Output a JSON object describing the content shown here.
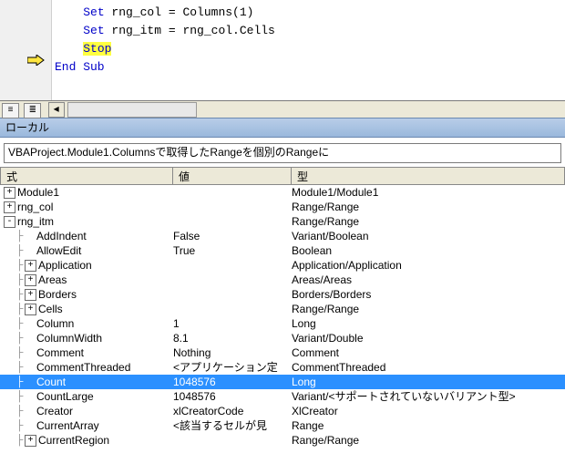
{
  "code": {
    "lines": [
      {
        "prefix": "Set",
        "rest": " rng_col = Columns(1)",
        "indent": 1
      },
      {
        "prefix": "Set",
        "rest": " rng_itm = rng_col.Cells",
        "indent": 1
      },
      {
        "prefix": "Stop",
        "rest": "",
        "indent": 1,
        "highlight": true,
        "marker": true
      },
      {
        "prefix": "End Sub",
        "rest": "",
        "indent": 0
      }
    ]
  },
  "locals_title": "ローカル",
  "context": "VBAProject.Module1.Columnsで取得したRangeを個別のRangeに",
  "headers": {
    "expr": "式",
    "val": "値",
    "type": "型"
  },
  "rows": [
    {
      "d": 0,
      "t": "+",
      "n": "Module1",
      "v": "",
      "ty": "Module1/Module1"
    },
    {
      "d": 0,
      "t": "+",
      "n": "rng_col",
      "v": "",
      "ty": "Range/Range"
    },
    {
      "d": 0,
      "t": "-",
      "n": "rng_itm",
      "v": "",
      "ty": "Range/Range"
    },
    {
      "d": 1,
      "t": " ",
      "n": "AddIndent",
      "v": "False",
      "ty": "Variant/Boolean"
    },
    {
      "d": 1,
      "t": " ",
      "n": "AllowEdit",
      "v": "True",
      "ty": "Boolean"
    },
    {
      "d": 1,
      "t": "+",
      "n": "Application",
      "v": "",
      "ty": "Application/Application"
    },
    {
      "d": 1,
      "t": "+",
      "n": "Areas",
      "v": "",
      "ty": "Areas/Areas"
    },
    {
      "d": 1,
      "t": "+",
      "n": "Borders",
      "v": "",
      "ty": "Borders/Borders"
    },
    {
      "d": 1,
      "t": "+",
      "n": "Cells",
      "v": "",
      "ty": "Range/Range"
    },
    {
      "d": 1,
      "t": " ",
      "n": "Column",
      "v": "1",
      "ty": "Long"
    },
    {
      "d": 1,
      "t": " ",
      "n": "ColumnWidth",
      "v": "8.1",
      "ty": "Variant/Double"
    },
    {
      "d": 1,
      "t": " ",
      "n": "Comment",
      "v": "Nothing",
      "ty": "Comment"
    },
    {
      "d": 1,
      "t": " ",
      "n": "CommentThreaded",
      "v": "<アプリケーション定",
      "ty": "CommentThreaded"
    },
    {
      "d": 1,
      "t": " ",
      "n": "Count",
      "v": "1048576",
      "ty": "Long",
      "sel": true
    },
    {
      "d": 1,
      "t": " ",
      "n": "CountLarge",
      "v": "1048576",
      "ty": "Variant/<サポートされていないバリアント型>"
    },
    {
      "d": 1,
      "t": " ",
      "n": "Creator",
      "v": "xlCreatorCode",
      "ty": "XlCreator"
    },
    {
      "d": 1,
      "t": " ",
      "n": "CurrentArray",
      "v": "<該当するセルが見",
      "ty": "Range"
    },
    {
      "d": 1,
      "t": "+",
      "n": "CurrentRegion",
      "v": "",
      "ty": "Range/Range"
    }
  ]
}
